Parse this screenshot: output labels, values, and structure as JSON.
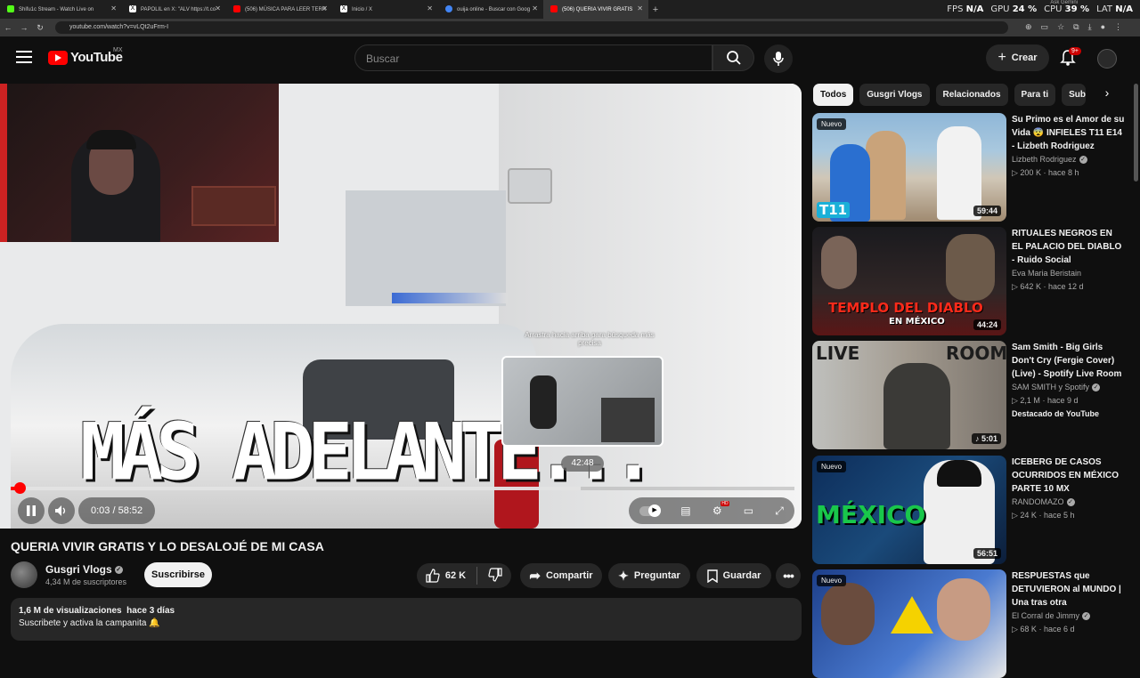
{
  "browser": {
    "tabs": [
      {
        "label": "Shifu1c Stream - Watch Live on",
        "color": "#53fc18"
      },
      {
        "label": "PAPOLIL en X: \"ALV https://t.co",
        "color": "#ffffff"
      },
      {
        "label": "(506) MÚSICA PARA LEER TERR",
        "color": "#ff0000"
      },
      {
        "label": "Inicio / X",
        "color": "#ffffff"
      },
      {
        "label": "ouija online - Buscar con Goog",
        "color": "#4285f4"
      },
      {
        "label": "(506) QUERIA VIVIR GRATIS",
        "color": "#ff0000"
      }
    ],
    "url": "youtube.com/watch?v=vLQt2uFrm-I",
    "ask_gemini": "Ask Gemini",
    "stats": {
      "fps_label": "FPS",
      "fps": "N/A",
      "gpu_label": "GPU",
      "gpu": "24 %",
      "cpu_label": "CPU",
      "cpu": "39 %",
      "lat_label": "LAT",
      "lat": "N/A"
    }
  },
  "header": {
    "logo_text": "YouTube",
    "country": "MX",
    "search_placeholder": "Buscar",
    "create_label": "Crear",
    "notif_count": "9+"
  },
  "player": {
    "overlay_text": "MÁS ADELANTE...",
    "hover_hint": "Arrastra hacia arriba para búsqueda más precisa",
    "hover_time": "42:48",
    "current_time": "0:03",
    "time_sep": " / ",
    "duration": "58:52",
    "progress_fraction": 0.001,
    "hover_fraction": 0.727
  },
  "video": {
    "title": "QUERIA VIVIR GRATIS Y LO DESALOJÉ DE MI CASA",
    "channel": "Gusgri Vlogs",
    "subscribers": "4,34 M de suscriptores",
    "subscribe_label": "Suscribirse",
    "likes": "62 K",
    "share_label": "Compartir",
    "ask_label": "Preguntar",
    "save_label": "Guardar",
    "views_date": "1,6 M de visualizaciones  hace 3 días",
    "desc_line": "Suscribete y activa la campanita 🔔"
  },
  "chips": [
    "Todos",
    "Gusgri Vlogs",
    "Relacionados",
    "Para ti",
    "Subi"
  ],
  "recs": [
    {
      "new": "Nuevo",
      "title": "Su Primo es el Amor de su Vida 😨 INFIELES T11 E14 - Lizbeth Rodriguez",
      "channel": "Lizbeth Rodriguez",
      "views": "200 K",
      "age": "hace 8 h",
      "duration": "59:44",
      "thumb_text": "T11"
    },
    {
      "new": "",
      "title": "RITUALES NEGROS EN EL PALACIO DEL DIABLO - Ruido Social",
      "channel": "Eva Maria Beristain",
      "views": "642 K",
      "age": "hace 12 d",
      "duration": "44:24",
      "thumb_text": "TEMPLO DEL DIABLO",
      "thumb_text2": "EN MÉXICO"
    },
    {
      "new": "",
      "title": "Sam Smith - Big Girls Don't Cry (Fergie Cover) (Live) - Spotify Live Room",
      "channel": "SAM SMITH y Spotify",
      "views": "2,1 M",
      "age": "hace 9 d",
      "duration": "5:01",
      "extra": "Destacado de YouTube",
      "thumb_text": "LIVE",
      "thumb_text2": "ROOM"
    },
    {
      "new": "Nuevo",
      "title": "ICEBERG DE CASOS OCURRIDOS EN MÉXICO PARTE 10 MX",
      "channel": "RANDOMAZO",
      "views": "24 K",
      "age": "hace 5 h",
      "duration": "56:51",
      "thumb_text": "MÉXICO"
    },
    {
      "new": "Nuevo",
      "title": "RESPUESTAS que DETUVIERON al MUNDO | Una tras otra",
      "channel": "El Corral de Jimmy",
      "views": "68 K",
      "age": "hace 6 d",
      "duration": ""
    }
  ]
}
